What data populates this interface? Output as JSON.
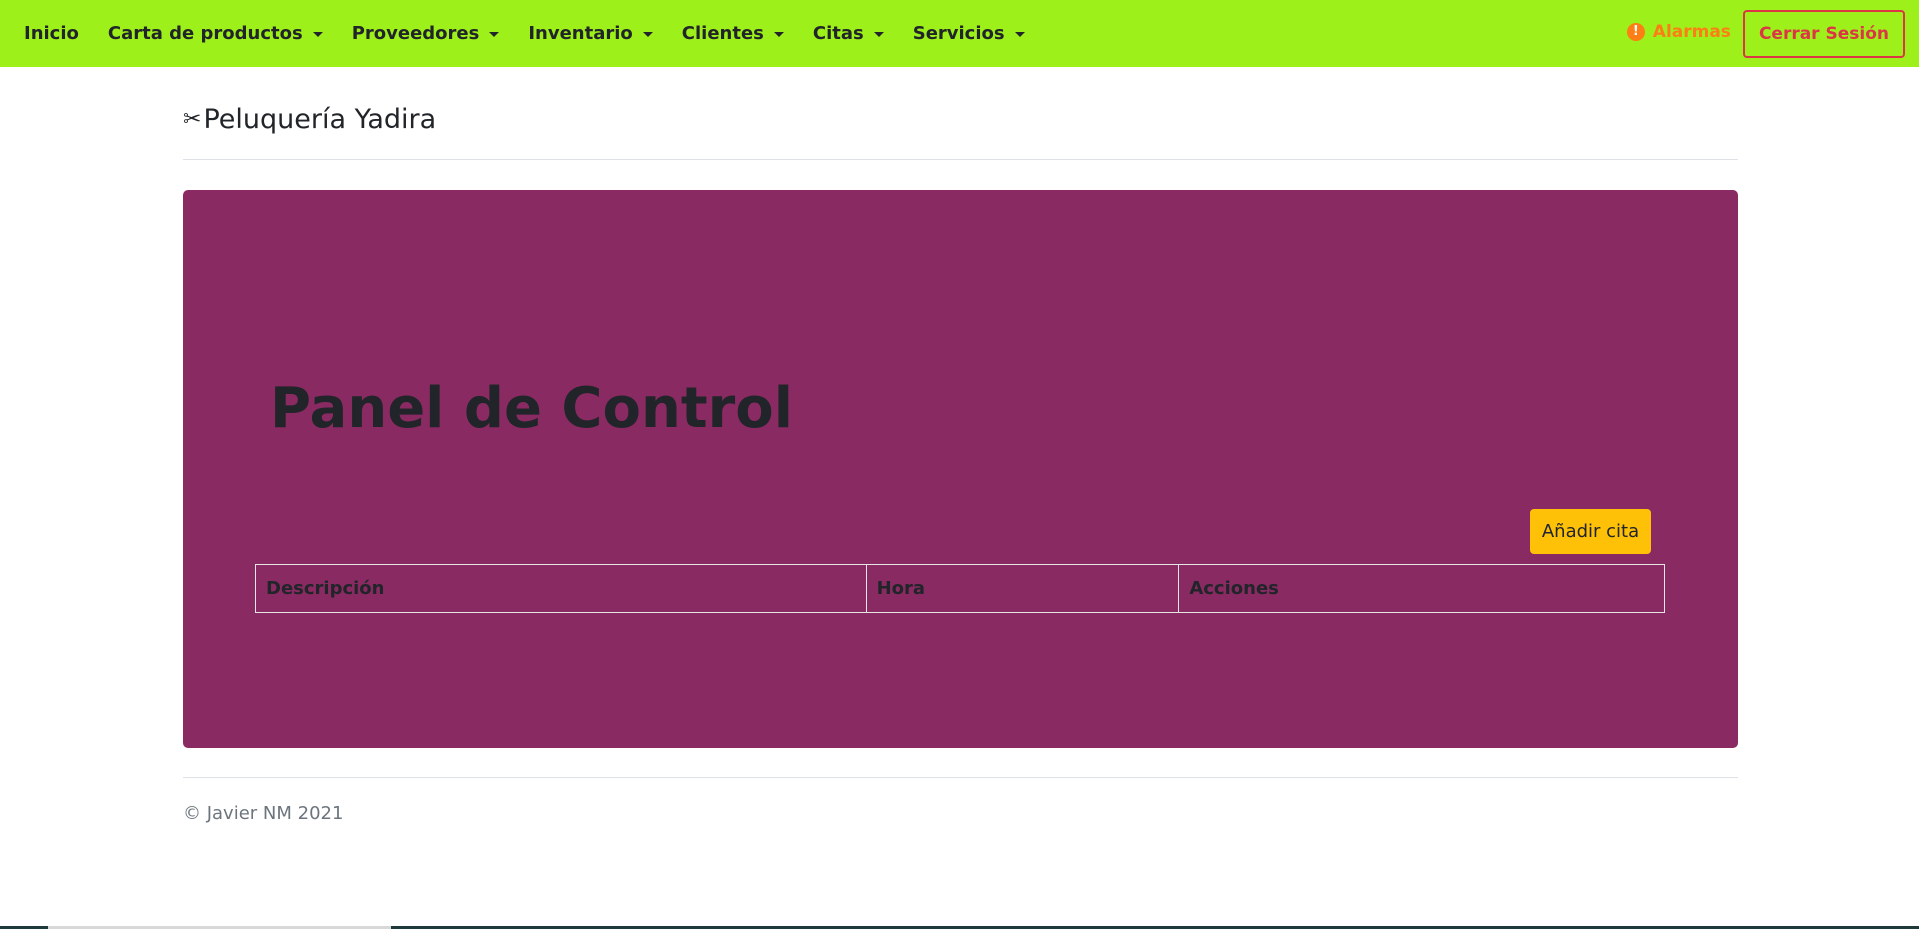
{
  "navbar": {
    "items": [
      {
        "label": "Inicio",
        "dropdown": false
      },
      {
        "label": "Carta de productos",
        "dropdown": true
      },
      {
        "label": "Proveedores",
        "dropdown": true
      },
      {
        "label": "Inventario",
        "dropdown": true
      },
      {
        "label": "Clientes",
        "dropdown": true
      },
      {
        "label": "Citas",
        "dropdown": true
      },
      {
        "label": "Servicios",
        "dropdown": true
      }
    ],
    "alarm_icon": "!",
    "alarm_label": "Alarmas",
    "logout_label": "Cerrar Sesión"
  },
  "header": {
    "icon": "scissors-icon",
    "brand": "Peluquería Yadira"
  },
  "panel": {
    "title": "Panel de Control",
    "add_button": "Añadir cita",
    "table": {
      "headers": [
        "Descripción",
        "Hora",
        "Acciones"
      ],
      "rows": []
    }
  },
  "footer": {
    "copyright": "© Javier NM 2021"
  },
  "colors": {
    "navbar": "#9ef01a",
    "panel": "#8a2a63",
    "accent_warning": "#ffc107",
    "alarm": "#fd7e14",
    "danger": "#dc3545"
  }
}
